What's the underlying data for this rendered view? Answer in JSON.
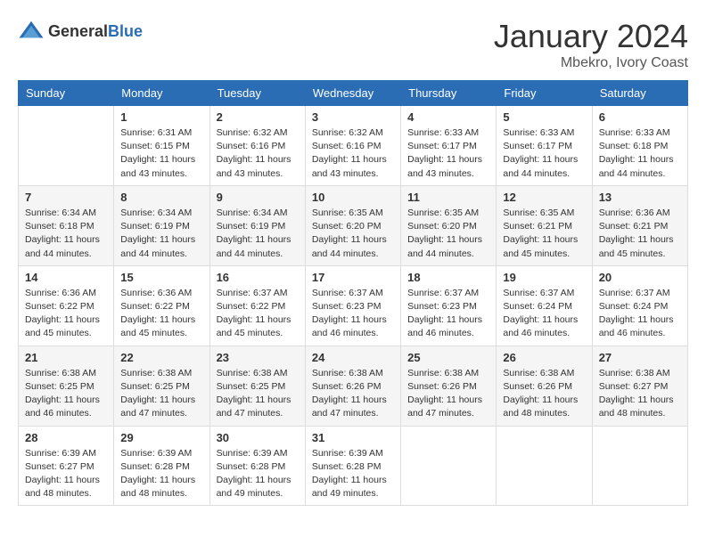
{
  "header": {
    "logo": {
      "text_general": "General",
      "text_blue": "Blue"
    },
    "title": "January 2024",
    "location": "Mbekro, Ivory Coast"
  },
  "calendar": {
    "days_of_week": [
      "Sunday",
      "Monday",
      "Tuesday",
      "Wednesday",
      "Thursday",
      "Friday",
      "Saturday"
    ],
    "weeks": [
      [
        {
          "day": "",
          "info": ""
        },
        {
          "day": "1",
          "info": "Sunrise: 6:31 AM\nSunset: 6:15 PM\nDaylight: 11 hours\nand 43 minutes."
        },
        {
          "day": "2",
          "info": "Sunrise: 6:32 AM\nSunset: 6:16 PM\nDaylight: 11 hours\nand 43 minutes."
        },
        {
          "day": "3",
          "info": "Sunrise: 6:32 AM\nSunset: 6:16 PM\nDaylight: 11 hours\nand 43 minutes."
        },
        {
          "day": "4",
          "info": "Sunrise: 6:33 AM\nSunset: 6:17 PM\nDaylight: 11 hours\nand 43 minutes."
        },
        {
          "day": "5",
          "info": "Sunrise: 6:33 AM\nSunset: 6:17 PM\nDaylight: 11 hours\nand 44 minutes."
        },
        {
          "day": "6",
          "info": "Sunrise: 6:33 AM\nSunset: 6:18 PM\nDaylight: 11 hours\nand 44 minutes."
        }
      ],
      [
        {
          "day": "7",
          "info": "Sunrise: 6:34 AM\nSunset: 6:18 PM\nDaylight: 11 hours\nand 44 minutes."
        },
        {
          "day": "8",
          "info": "Sunrise: 6:34 AM\nSunset: 6:19 PM\nDaylight: 11 hours\nand 44 minutes."
        },
        {
          "day": "9",
          "info": "Sunrise: 6:34 AM\nSunset: 6:19 PM\nDaylight: 11 hours\nand 44 minutes."
        },
        {
          "day": "10",
          "info": "Sunrise: 6:35 AM\nSunset: 6:20 PM\nDaylight: 11 hours\nand 44 minutes."
        },
        {
          "day": "11",
          "info": "Sunrise: 6:35 AM\nSunset: 6:20 PM\nDaylight: 11 hours\nand 44 minutes."
        },
        {
          "day": "12",
          "info": "Sunrise: 6:35 AM\nSunset: 6:21 PM\nDaylight: 11 hours\nand 45 minutes."
        },
        {
          "day": "13",
          "info": "Sunrise: 6:36 AM\nSunset: 6:21 PM\nDaylight: 11 hours\nand 45 minutes."
        }
      ],
      [
        {
          "day": "14",
          "info": "Sunrise: 6:36 AM\nSunset: 6:22 PM\nDaylight: 11 hours\nand 45 minutes."
        },
        {
          "day": "15",
          "info": "Sunrise: 6:36 AM\nSunset: 6:22 PM\nDaylight: 11 hours\nand 45 minutes."
        },
        {
          "day": "16",
          "info": "Sunrise: 6:37 AM\nSunset: 6:22 PM\nDaylight: 11 hours\nand 45 minutes."
        },
        {
          "day": "17",
          "info": "Sunrise: 6:37 AM\nSunset: 6:23 PM\nDaylight: 11 hours\nand 46 minutes."
        },
        {
          "day": "18",
          "info": "Sunrise: 6:37 AM\nSunset: 6:23 PM\nDaylight: 11 hours\nand 46 minutes."
        },
        {
          "day": "19",
          "info": "Sunrise: 6:37 AM\nSunset: 6:24 PM\nDaylight: 11 hours\nand 46 minutes."
        },
        {
          "day": "20",
          "info": "Sunrise: 6:37 AM\nSunset: 6:24 PM\nDaylight: 11 hours\nand 46 minutes."
        }
      ],
      [
        {
          "day": "21",
          "info": "Sunrise: 6:38 AM\nSunset: 6:25 PM\nDaylight: 11 hours\nand 46 minutes."
        },
        {
          "day": "22",
          "info": "Sunrise: 6:38 AM\nSunset: 6:25 PM\nDaylight: 11 hours\nand 47 minutes."
        },
        {
          "day": "23",
          "info": "Sunrise: 6:38 AM\nSunset: 6:25 PM\nDaylight: 11 hours\nand 47 minutes."
        },
        {
          "day": "24",
          "info": "Sunrise: 6:38 AM\nSunset: 6:26 PM\nDaylight: 11 hours\nand 47 minutes."
        },
        {
          "day": "25",
          "info": "Sunrise: 6:38 AM\nSunset: 6:26 PM\nDaylight: 11 hours\nand 47 minutes."
        },
        {
          "day": "26",
          "info": "Sunrise: 6:38 AM\nSunset: 6:26 PM\nDaylight: 11 hours\nand 48 minutes."
        },
        {
          "day": "27",
          "info": "Sunrise: 6:38 AM\nSunset: 6:27 PM\nDaylight: 11 hours\nand 48 minutes."
        }
      ],
      [
        {
          "day": "28",
          "info": "Sunrise: 6:39 AM\nSunset: 6:27 PM\nDaylight: 11 hours\nand 48 minutes."
        },
        {
          "day": "29",
          "info": "Sunrise: 6:39 AM\nSunset: 6:28 PM\nDaylight: 11 hours\nand 48 minutes."
        },
        {
          "day": "30",
          "info": "Sunrise: 6:39 AM\nSunset: 6:28 PM\nDaylight: 11 hours\nand 49 minutes."
        },
        {
          "day": "31",
          "info": "Sunrise: 6:39 AM\nSunset: 6:28 PM\nDaylight: 11 hours\nand 49 minutes."
        },
        {
          "day": "",
          "info": ""
        },
        {
          "day": "",
          "info": ""
        },
        {
          "day": "",
          "info": ""
        }
      ]
    ]
  }
}
